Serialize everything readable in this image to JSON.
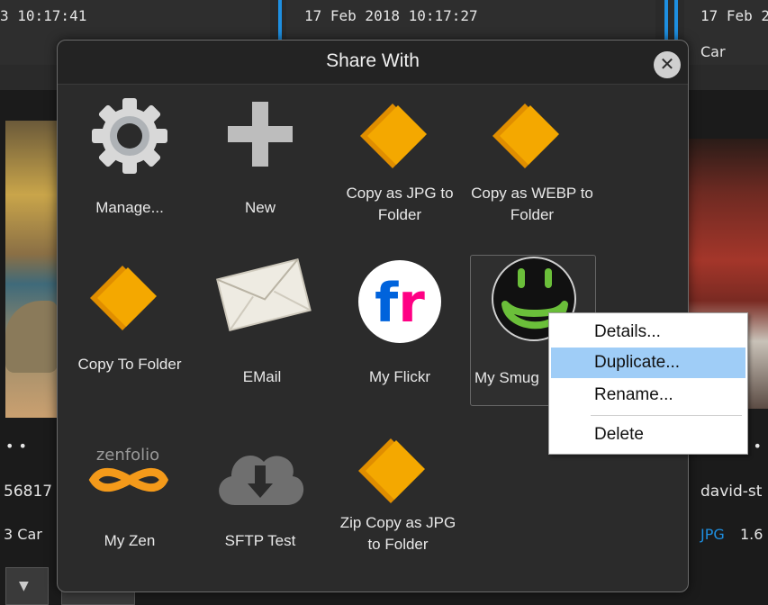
{
  "gallery": {
    "cells": [
      {
        "timestamp": "3 10:17:41",
        "tag": ""
      },
      {
        "timestamp": "17 Feb 2018 10:17:27",
        "tag": ""
      },
      {
        "timestamp": "17 Feb 2",
        "tag": "Car"
      }
    ],
    "left_info": {
      "dots": "• •",
      "name": "56817",
      "meta": "3  Car"
    },
    "right_info": {
      "dots": "• •",
      "name": "david-st",
      "format": "JPG",
      "size": "1.6"
    }
  },
  "dialog": {
    "title": "Share With",
    "close_symbol": "✕",
    "tiles": [
      {
        "name": "manage",
        "icon": "gear-icon",
        "label": "Manage..."
      },
      {
        "name": "new",
        "icon": "plus-icon",
        "label": "New"
      },
      {
        "name": "copy-jpg-folder",
        "icon": "folder-icon",
        "label": "Copy as JPG to Folder"
      },
      {
        "name": "copy-webp-folder",
        "icon": "folder-icon",
        "label": "Copy as WEBP to Folder"
      },
      {
        "name": "copy-to-folder",
        "icon": "folder-icon",
        "label": "Copy To Folder"
      },
      {
        "name": "email",
        "icon": "envelope-icon",
        "label": "EMail"
      },
      {
        "name": "my-flickr",
        "icon": "flickr-icon",
        "label": "My Flickr",
        "icon_text": "fr"
      },
      {
        "name": "my-smugmug",
        "icon": "smugmug-icon",
        "label": "My Smug"
      },
      {
        "name": "my-zen",
        "icon": "zenfolio-icon",
        "label": "My Zen",
        "icon_text": "zenfolio"
      },
      {
        "name": "sftp-test",
        "icon": "cloud-download-icon",
        "label": "SFTP Test"
      },
      {
        "name": "zip-copy-jpg",
        "icon": "folder-icon",
        "label": "Zip Copy as JPG to Folder"
      }
    ]
  },
  "context_menu": {
    "items": [
      {
        "label": "Details...",
        "highlighted": false
      },
      {
        "label": "Duplicate...",
        "highlighted": true
      },
      {
        "label": "Rename...",
        "highlighted": false
      },
      {
        "label": "Delete",
        "highlighted": false
      }
    ]
  },
  "colors": {
    "accent": "#1e8fe0",
    "folder": "#f0a000",
    "highlight": "#9fcdf7"
  }
}
